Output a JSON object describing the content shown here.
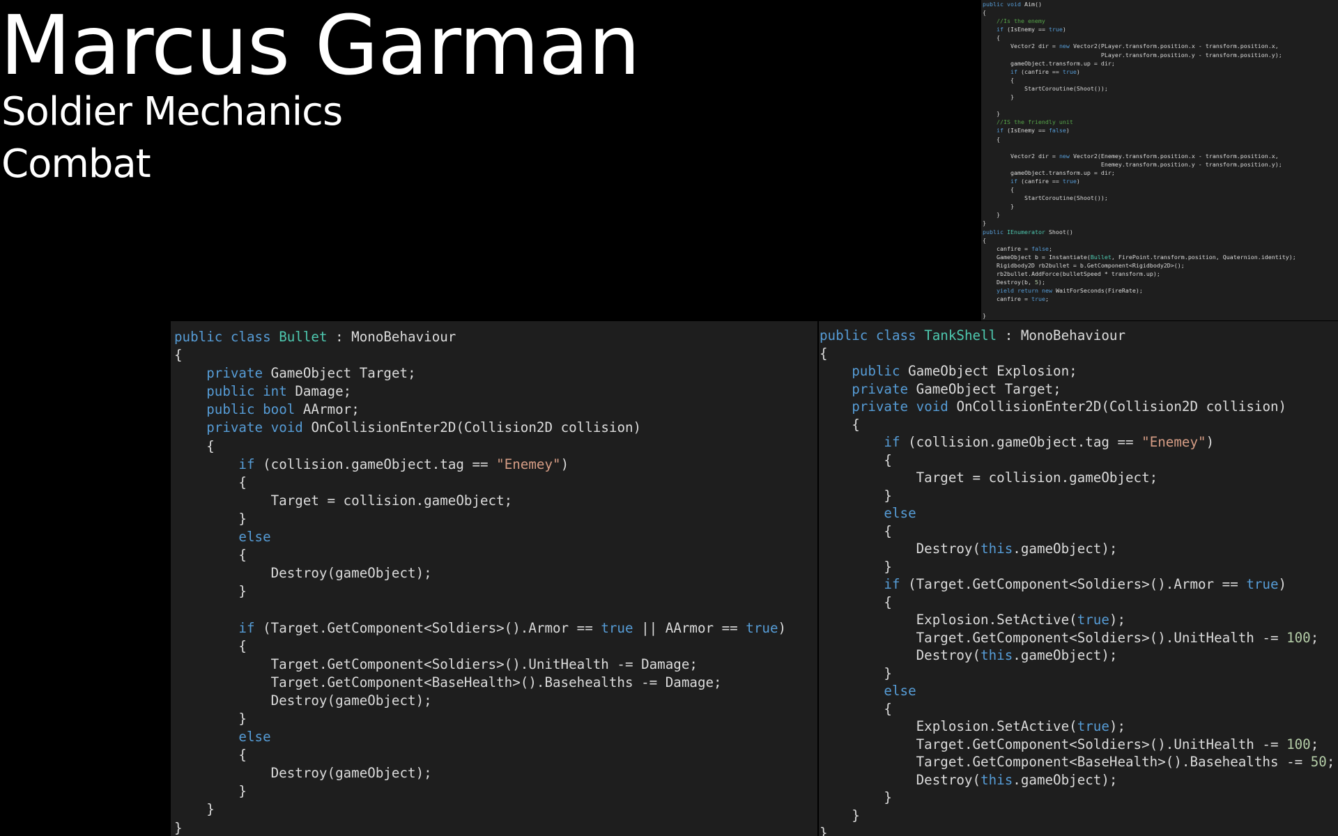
{
  "header": {
    "name": "Marcus Garman",
    "subtitle_1": "Soldier Mechanics",
    "subtitle_2": "Combat"
  },
  "colors": {
    "background": "#000000",
    "editor_bg": "#1e1e1e",
    "default_text": "#dcdcdc",
    "keyword": "#569cd6",
    "type": "#4ec9b0",
    "string": "#d69d85",
    "comment": "#57a64a",
    "number": "#b5cea8"
  },
  "code_aim": [
    "public void Aim()",
    "{",
    "    //Is the enemy",
    "    if (IsEnemy == true)",
    "    {",
    "        Vector2 dir = new Vector2(PLayer.transform.position.x - transform.position.x,",
    "                                  PLayer.transform.position.y - transform.position.y);",
    "        gameObject.transform.up = dir;",
    "        if (canfire == true)",
    "        {",
    "            StartCoroutine(Shoot());",
    "        }",
    "",
    "    }",
    "    //IS the friendly unit",
    "    if (IsEnemy == false)",
    "    {",
    "",
    "        Vector2 dir = new Vector2(Enemey.transform.position.x - transform.position.x,",
    "                                  Enemey.transform.position.y - transform.position.y);",
    "        gameObject.transform.up = dir;",
    "        if (canfire == true)",
    "        {",
    "            StartCoroutine(Shoot());",
    "        }",
    "    }",
    "}",
    "public IEnumerator Shoot()",
    "{",
    "    canfire = false;",
    "    GameObject b = Instantiate(Bullet, FirePoint.transform.position, Quaternion.identity);",
    "    Rigidbody2D rb2bullet = b.GetComponent<Rigidbody2D>();",
    "    rb2bullet.AddForce(bulletSpeed * transform.up);",
    "    Destroy(b, 5);",
    "    yield return new WaitForSeconds(FireRate);",
    "    canfire = true;",
    "",
    "}"
  ],
  "code_bullet": [
    "public class Bullet : MonoBehaviour",
    "{",
    "    private GameObject Target;",
    "    public int Damage;",
    "    public bool AArmor;",
    "    private void OnCollisionEnter2D(Collision2D collision)",
    "    {",
    "        if (collision.gameObject.tag == \"Enemey\")",
    "        {",
    "            Target = collision.gameObject;",
    "        }",
    "        else",
    "        {",
    "            Destroy(gameObject);",
    "        }",
    "",
    "        if (Target.GetComponent<Soldiers>().Armor == true || AArmor == true)",
    "        {",
    "            Target.GetComponent<Soldiers>().UnitHealth -= Damage;",
    "            Target.GetComponent<BaseHealth>().Basehealths -= Damage;",
    "            Destroy(gameObject);",
    "        }",
    "        else",
    "        {",
    "            Destroy(gameObject);",
    "        }",
    "    }",
    "}"
  ],
  "code_tankshell": [
    "public class TankShell : MonoBehaviour",
    "{",
    "    public GameObject Explosion;",
    "    private GameObject Target;",
    "    private void OnCollisionEnter2D(Collision2D collision)",
    "    {",
    "        if (collision.gameObject.tag == \"Enemey\")",
    "        {",
    "            Target = collision.gameObject;",
    "        }",
    "        else",
    "        {",
    "            Destroy(this.gameObject);",
    "        }",
    "        if (Target.GetComponent<Soldiers>().Armor == true)",
    "        {",
    "            Explosion.SetActive(true);",
    "            Target.GetComponent<Soldiers>().UnitHealth -= 100;",
    "            Destroy(this.gameObject);",
    "        }",
    "        else",
    "        {",
    "            Explosion.SetActive(true);",
    "            Target.GetComponent<Soldiers>().UnitHealth -= 100;",
    "            Target.GetComponent<BaseHealth>().Basehealths -= 50;",
    "            Destroy(this.gameObject);",
    "        }",
    "    }",
    "}"
  ]
}
